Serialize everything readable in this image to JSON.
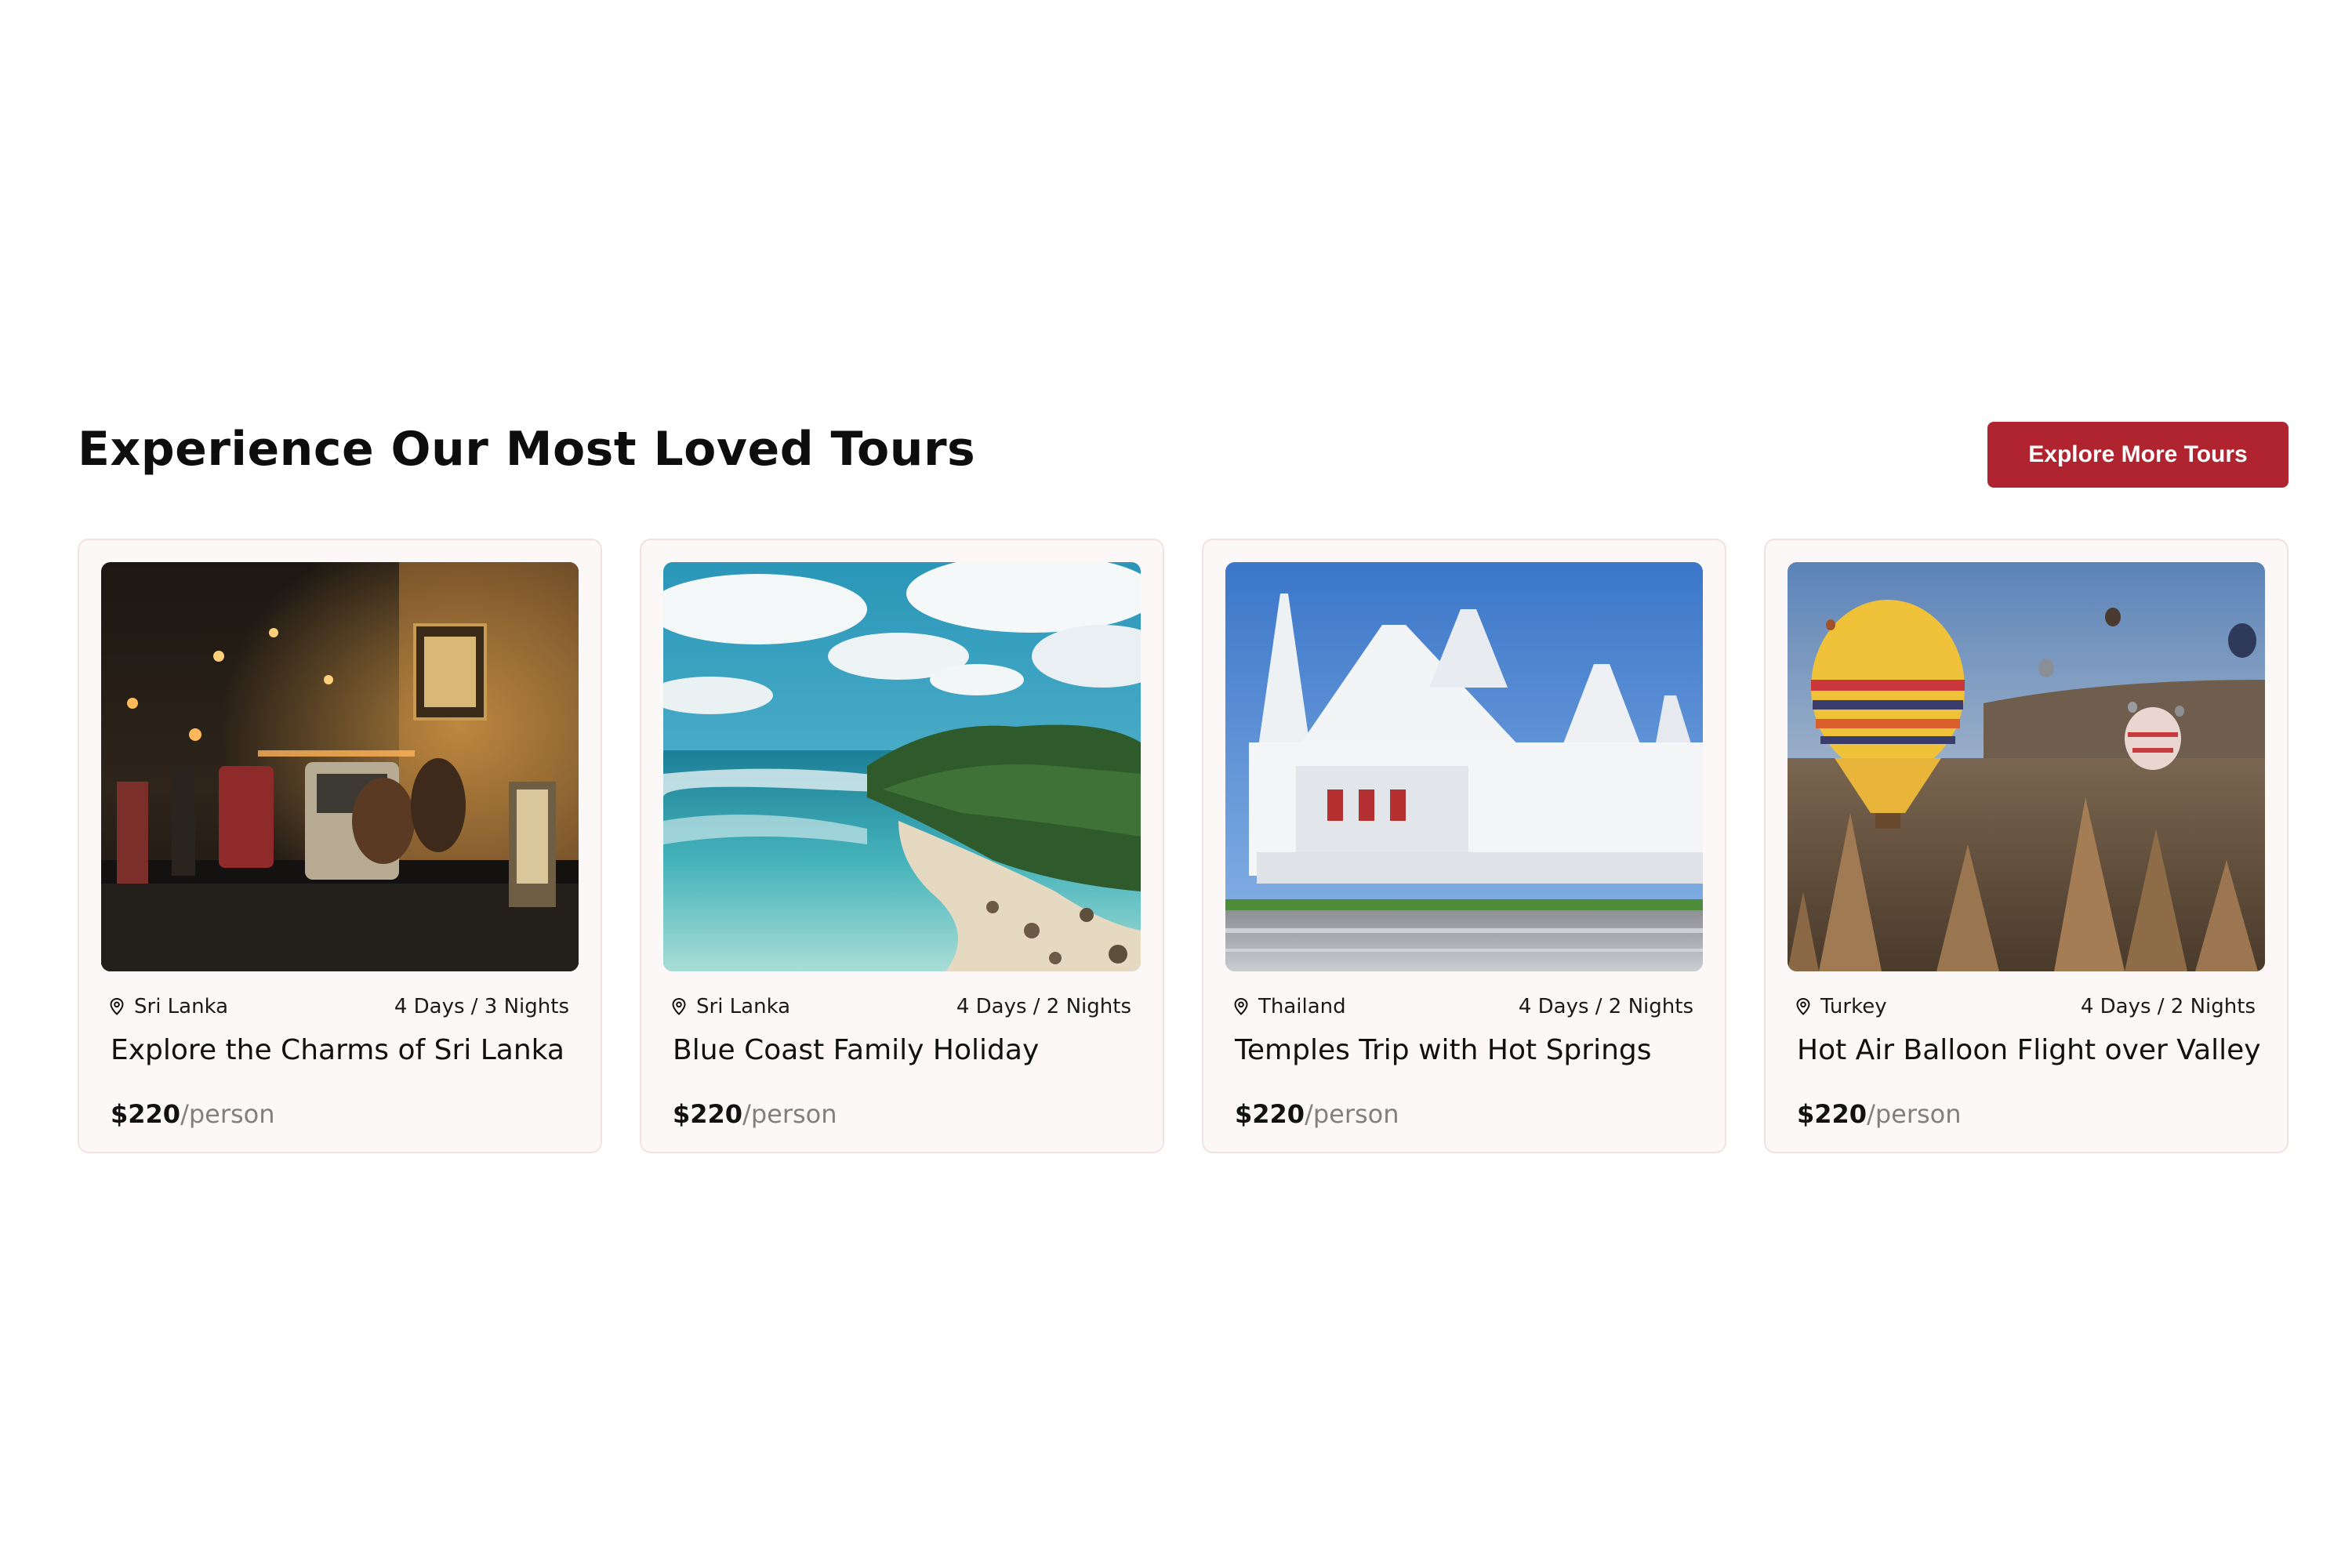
{
  "section": {
    "title": "Experience Our Most Loved Tours",
    "button_label": "Explore More Tours"
  },
  "colors": {
    "accent": "#b0242f",
    "card_background": "#fdf8f8",
    "card_border": "#f1e2e2",
    "price_unit": "#808080"
  },
  "tours": [
    {
      "location": "Sri Lanka",
      "duration": "4 Days / 3 Nights",
      "title": "Explore the Charms of Sri Lanka",
      "price": "$220",
      "price_unit": "/person",
      "image": "night-street-market-photo"
    },
    {
      "location": "Sri Lanka",
      "duration": "4 Days / 2 Nights",
      "title": "Blue Coast Family Holiday",
      "price": "$220",
      "price_unit": "/person",
      "image": "tropical-beach-photo"
    },
    {
      "location": "Thailand",
      "duration": "4 Days / 2 Nights",
      "title": "Temples Trip with Hot Springs",
      "price": "$220",
      "price_unit": "/person",
      "image": "white-temple-photo"
    },
    {
      "location": "Turkey",
      "duration": "4 Days / 2 Nights",
      "title": "Hot Air Balloon Flight over Valley",
      "price": "$220",
      "price_unit": "/person",
      "image": "hot-air-balloons-photo"
    }
  ]
}
